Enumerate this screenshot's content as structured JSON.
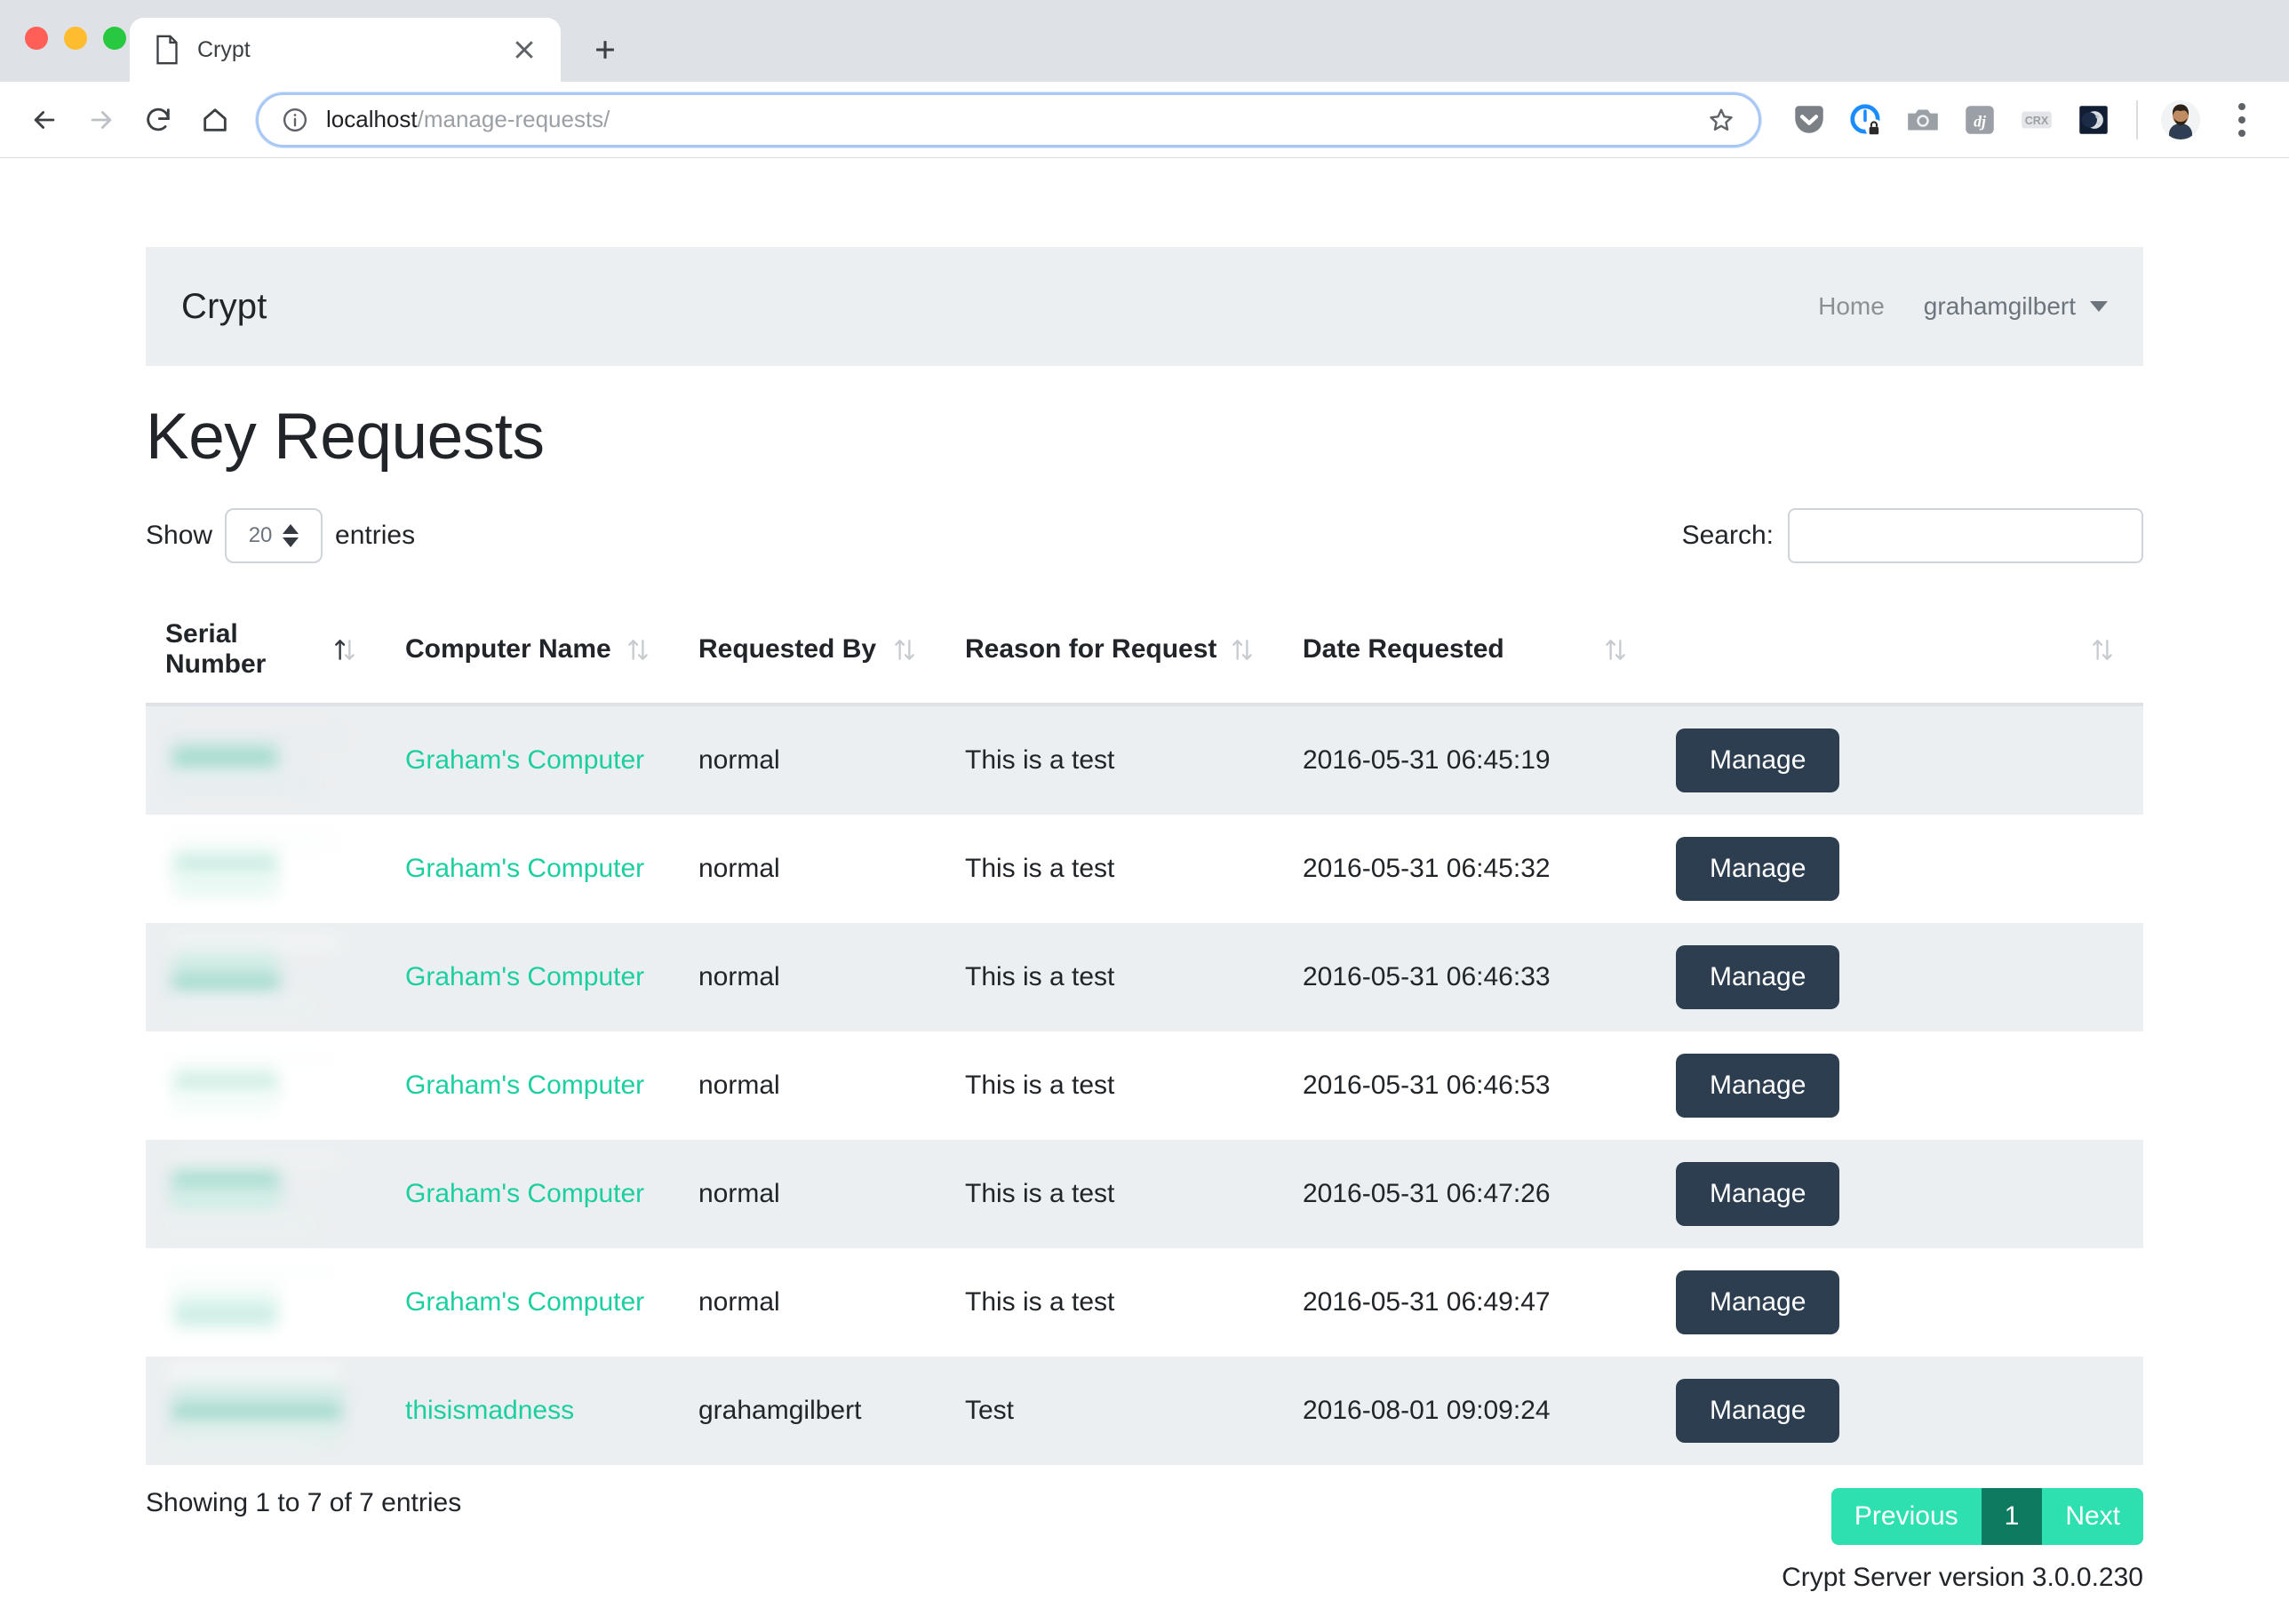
{
  "browser": {
    "tab": {
      "title": "Crypt",
      "favicon_icon": "document-icon",
      "close_icon": "close-icon"
    },
    "new_tab_icon": "plus-icon",
    "back_icon": "arrow-left-icon",
    "forward_icon": "arrow-right-icon",
    "reload_icon": "reload-icon",
    "home_icon": "home-icon",
    "omnibox": {
      "info_icon": "info-circle-icon",
      "url_host": "localhost",
      "url_path": "/manage-requests/",
      "star_icon": "star-icon"
    },
    "extensions": [
      {
        "name": "pocket-icon"
      },
      {
        "name": "onepassword-lock-icon"
      },
      {
        "name": "camera-icon"
      },
      {
        "name": "django-icon"
      },
      {
        "name": "crx-icon"
      },
      {
        "name": "moon-icon"
      }
    ],
    "avatar_icon": "user-avatar",
    "menu_icon": "kebab-menu-icon"
  },
  "navbar": {
    "brand": "Crypt",
    "home_label": "Home",
    "user_label": "grahamgilbert",
    "caret_icon": "chevron-down-icon"
  },
  "page": {
    "title": "Key Requests",
    "version": "Crypt Server version 3.0.0.230"
  },
  "controls": {
    "show_label": "Show",
    "entries_label": "entries",
    "length_value": "20",
    "stepper_icon": "updown-stepper-icon",
    "search_label": "Search:",
    "search_value": "",
    "search_placeholder": ""
  },
  "table": {
    "columns": [
      {
        "label": "Serial Number",
        "sort": "asc"
      },
      {
        "label": "Computer Name",
        "sort": "none"
      },
      {
        "label": "Requested By",
        "sort": "none"
      },
      {
        "label": "Reason for Request",
        "sort": "none"
      },
      {
        "label": "Date Requested",
        "sort": "none"
      },
      {
        "label": "",
        "sort": "none"
      }
    ],
    "rows": [
      {
        "serial": "",
        "computer": "Graham's Computer",
        "requested_by": "normal",
        "reason": "This is a test",
        "date": "2016-05-31 06:45:19",
        "action": "Manage"
      },
      {
        "serial": "",
        "computer": "Graham's Computer",
        "requested_by": "normal",
        "reason": "This is a test",
        "date": "2016-05-31 06:45:32",
        "action": "Manage"
      },
      {
        "serial": "",
        "computer": "Graham's Computer",
        "requested_by": "normal",
        "reason": "This is a test",
        "date": "2016-05-31 06:46:33",
        "action": "Manage"
      },
      {
        "serial": "",
        "computer": "Graham's Computer",
        "requested_by": "normal",
        "reason": "This is a test",
        "date": "2016-05-31 06:46:53",
        "action": "Manage"
      },
      {
        "serial": "",
        "computer": "Graham's Computer",
        "requested_by": "normal",
        "reason": "This is a test",
        "date": "2016-05-31 06:47:26",
        "action": "Manage"
      },
      {
        "serial": "",
        "computer": "Graham's Computer",
        "requested_by": "normal",
        "reason": "This is a test",
        "date": "2016-05-31 06:49:47",
        "action": "Manage"
      },
      {
        "serial": "",
        "computer": "thisismadness",
        "requested_by": "grahamgilbert",
        "reason": "Test",
        "date": "2016-08-01 09:09:24",
        "action": "Manage"
      }
    ]
  },
  "footer": {
    "info": "Showing 1 to 7 of 7 entries",
    "previous_label": "Previous",
    "page_label": "1",
    "next_label": "Next"
  },
  "colors": {
    "link_green": "#1ccfa0",
    "pager_green": "#2ee0af",
    "pager_active_green": "#0e7a5f",
    "button_navy": "#2c3e50",
    "navbar_bg": "#eceff1",
    "stripe_bg": "#eceff1"
  }
}
